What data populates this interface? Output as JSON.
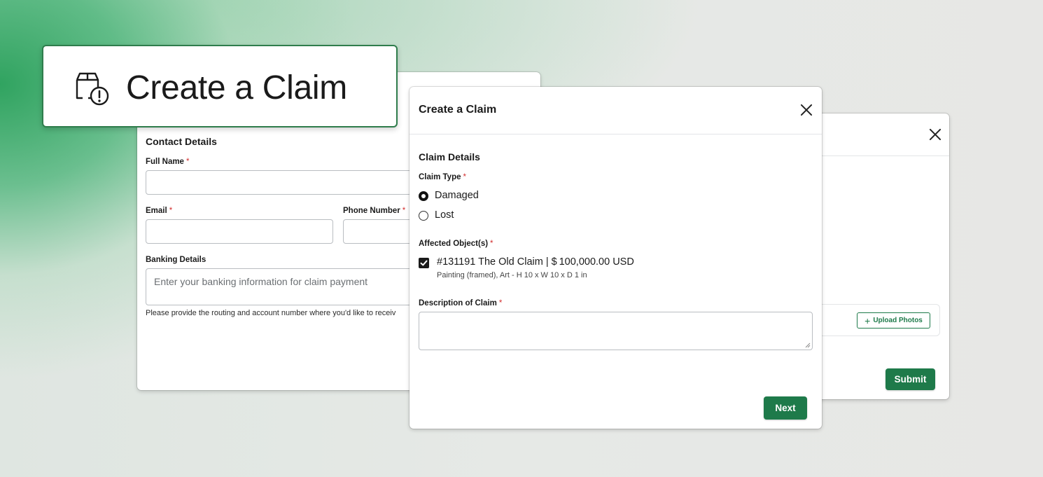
{
  "hero": {
    "title": "Create a Claim",
    "icon": "package-alert-icon"
  },
  "contact_form": {
    "section_title": "Contact Details",
    "full_name_label": "Full Name",
    "email_label": "Email",
    "phone_label": "Phone Number",
    "banking_label": "Banking Details",
    "banking_placeholder": "Enter your banking information for claim payment",
    "banking_help": "Please provide the routing and account number where you'd like to receiv"
  },
  "claim_modal": {
    "title": "Create a Claim",
    "section_title": "Claim Details",
    "claim_type_label": "Claim Type",
    "claim_type_options": [
      {
        "label": "Damaged",
        "selected": true
      },
      {
        "label": "Lost",
        "selected": false
      }
    ],
    "affected_label": "Affected Object(s)",
    "object_title": "#131191 The Old Claim | $ 100,000.00 USD",
    "object_subtitle": "Painting (framed), Art - H 10 x W 10 x D 1 in",
    "object_checked": true,
    "description_label": "Description of Claim",
    "next_label": "Next"
  },
  "photo_modal": {
    "upload_label": "Upload Photos",
    "submit_label": "Submit"
  },
  "required_mark": "*",
  "colors": {
    "accent": "#1e7a4a",
    "required": "#d32f2f"
  }
}
